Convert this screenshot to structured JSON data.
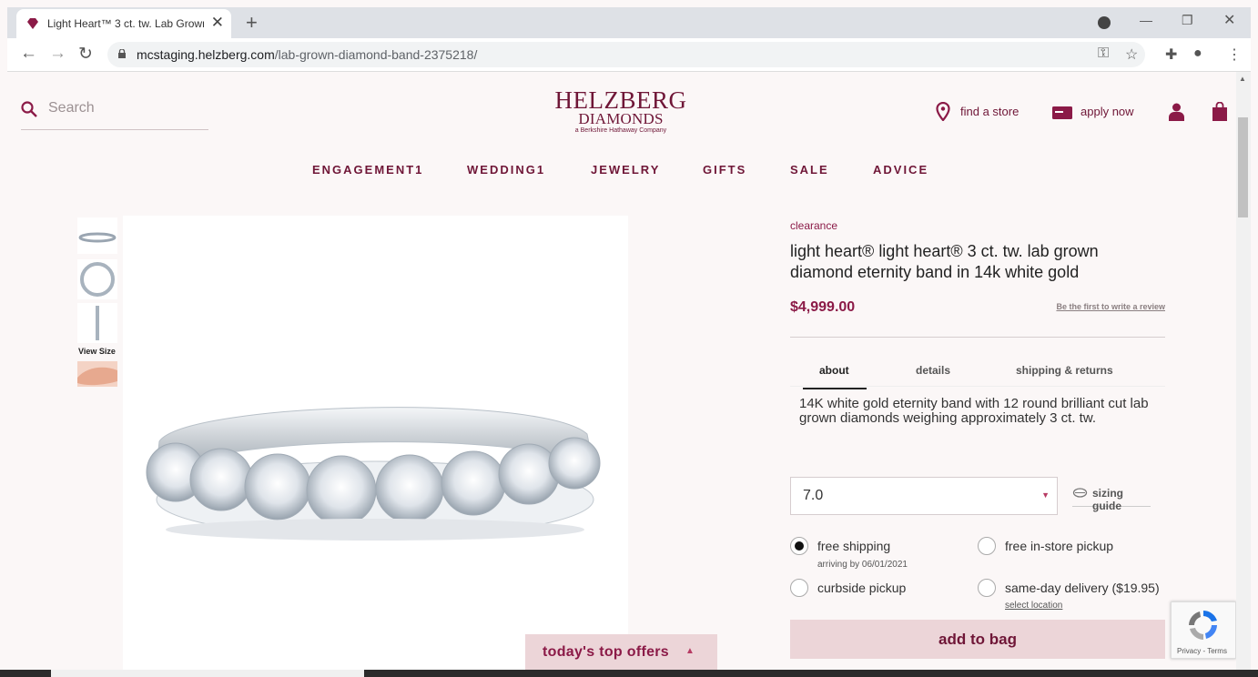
{
  "browser": {
    "tab_title": "Light Heart™ 3 ct. tw. Lab Grown",
    "tab_close": "✕",
    "new_tab": "+",
    "url_domain": "mcstaging.helzberg.com",
    "url_path": "/lab-grown-diamond-band-2375218/"
  },
  "header": {
    "search_placeholder": "Search",
    "logo_line1": "HELZBERG",
    "logo_line2": "DIAMONDS",
    "logo_tagline": "a Berkshire Hathaway Company",
    "find_store": "find a store",
    "apply_now": "apply now"
  },
  "nav": {
    "items": [
      "ENGAGEMENT1",
      "WEDDING1",
      "JEWELRY",
      "GIFTS",
      "SALE",
      "ADVICE"
    ]
  },
  "gallery": {
    "view_size": "View Size"
  },
  "product": {
    "badge": "clearance",
    "title": "light heart® light heart® 3 ct. tw. lab grown diamond eternity band in 14k white gold",
    "price": "$4,999.00",
    "review_link": "Be the first to write a review",
    "tabs": [
      "about",
      "details",
      "shipping & returns"
    ],
    "about": "14K white gold eternity band with 12 round brilliant cut lab grown diamonds weighing approximately 3 ct. tw.",
    "size": "7.0",
    "sizing_guide": "sizing guide",
    "delivery": {
      "free_shipping": "free shipping",
      "arriving": "arriving by 06/01/2021",
      "in_store": "free in-store pickup",
      "curbside": "curbside pickup",
      "same_day": "same-day delivery ($19.95)",
      "select_location": "select location"
    },
    "add_to_bag": "add to bag"
  },
  "offers": {
    "label": "today's top offers"
  },
  "recaptcha": {
    "text": "Privacy - Terms"
  },
  "colors": {
    "brand": "#6f1637",
    "accent": "#8b1a47",
    "button_bg": "#ecd5d8"
  }
}
